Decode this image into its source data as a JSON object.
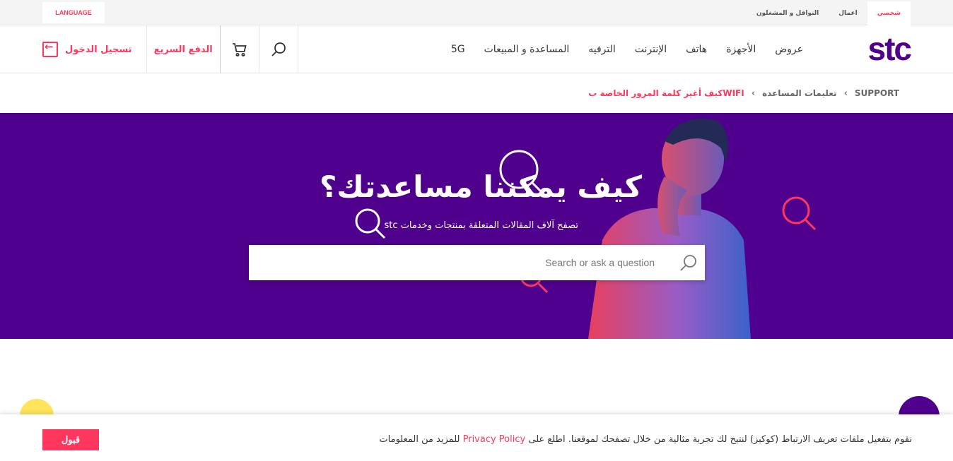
{
  "colors": {
    "brand_purple": "#4f008c",
    "accent_pink": "#ff375e"
  },
  "utility_bar": {
    "language_label": "LANGUAGE",
    "segments": [
      {
        "label": "شخصي",
        "active": true
      },
      {
        "label": "اعمال",
        "active": false
      },
      {
        "label": "النواقل و المشغلون",
        "active": false
      }
    ]
  },
  "header": {
    "logo_text": "stc",
    "nav": [
      "عروض",
      "الأجهزة",
      "هاتف",
      "الإنترنت",
      "الترفيه",
      "المساعدة و المبيعات",
      "5G"
    ],
    "login_label": "تسجيل الدخول",
    "quickpay_label": "الدفع السريع",
    "icons": {
      "cart": "cart-icon",
      "search": "search-icon",
      "login": "logout-arrow-icon"
    }
  },
  "breadcrumb": {
    "items": [
      "SUPPORT",
      "تعليمات المساعدة",
      "كيف أغير كلمة المرور الخاصة بWIFI"
    ]
  },
  "hero": {
    "title": "كيف يمكننا مساعدتك؟",
    "subtitle": "تصفح آلاف المقالات المتعلقة بمنتجات وخدمات stc",
    "search_placeholder": "Search or ask a question"
  },
  "cookie": {
    "text_before": "نقوم بتفعيل ملفات تعريف الارتباط (كوكيز) لنتيح لك تجربة مثالية من خلال تصفحك لموقعنا. اطلع على",
    "policy_link": "Privacy Policy",
    "text_after": "للمزيد من المعلومات",
    "accept_label": "قبول"
  }
}
